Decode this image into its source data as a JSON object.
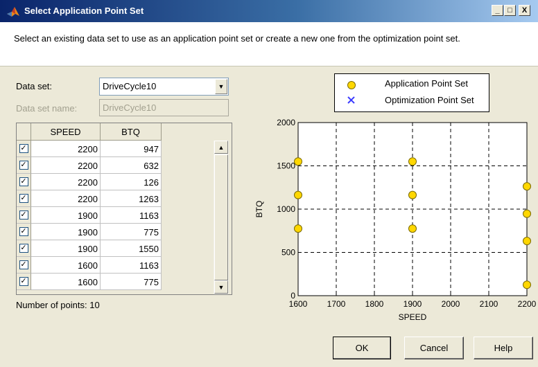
{
  "window": {
    "title": "Select Application Point Set",
    "minimize_glyph": "_",
    "maximize_glyph": "□",
    "close_glyph": "X"
  },
  "instructions": "Select an existing data set to use as an application point set or create a new one from the optimization point set.",
  "form": {
    "data_set_label": "Data set:",
    "data_set_value": "DriveCycle10",
    "data_set_name_label": "Data set name:",
    "data_set_name_value": "DriveCycle10"
  },
  "table": {
    "columns": [
      "SPEED",
      "BTQ"
    ],
    "checkmark": "✓",
    "rows": [
      {
        "checked": true,
        "speed": "2200",
        "btq": "947"
      },
      {
        "checked": true,
        "speed": "2200",
        "btq": "632"
      },
      {
        "checked": true,
        "speed": "2200",
        "btq": "126"
      },
      {
        "checked": true,
        "speed": "2200",
        "btq": "1263"
      },
      {
        "checked": true,
        "speed": "1900",
        "btq": "1163"
      },
      {
        "checked": true,
        "speed": "1900",
        "btq": "775"
      },
      {
        "checked": true,
        "speed": "1900",
        "btq": "1550"
      },
      {
        "checked": true,
        "speed": "1600",
        "btq": "1163"
      },
      {
        "checked": true,
        "speed": "1600",
        "btq": "775"
      }
    ]
  },
  "points_summary": "Number of points: 10",
  "chart_data": {
    "type": "scatter",
    "xlabel": "SPEED",
    "ylabel": "BTQ",
    "xlim": [
      1600,
      2200
    ],
    "ylim": [
      0,
      2000
    ],
    "x_ticks": [
      "1600",
      "1700",
      "1800",
      "1900",
      "2000",
      "2100",
      "2200"
    ],
    "y_ticks": [
      "0",
      "500",
      "1000",
      "1500",
      "2000"
    ],
    "grid": true,
    "grid_style": "dashed",
    "legend_position": "top-right",
    "legend": [
      {
        "label": "Application Point Set",
        "marker": "circle",
        "color": "#ffd700",
        "edge": "#7a6a00"
      },
      {
        "label": "Optimization Point Set",
        "marker": "x",
        "color": "#3c3cff"
      }
    ],
    "series": [
      {
        "name": "Application Point Set",
        "points": [
          {
            "x": 2200,
            "y": 947
          },
          {
            "x": 2200,
            "y": 632
          },
          {
            "x": 2200,
            "y": 126
          },
          {
            "x": 2200,
            "y": 1263
          },
          {
            "x": 1900,
            "y": 1163
          },
          {
            "x": 1900,
            "y": 775
          },
          {
            "x": 1900,
            "y": 1550
          },
          {
            "x": 1600,
            "y": 1163
          },
          {
            "x": 1600,
            "y": 775
          },
          {
            "x": 1600,
            "y": 1550
          }
        ]
      },
      {
        "name": "Optimization Point Set",
        "points": []
      }
    ]
  },
  "buttons": {
    "ok": "OK",
    "cancel": "Cancel",
    "help": "Help"
  }
}
